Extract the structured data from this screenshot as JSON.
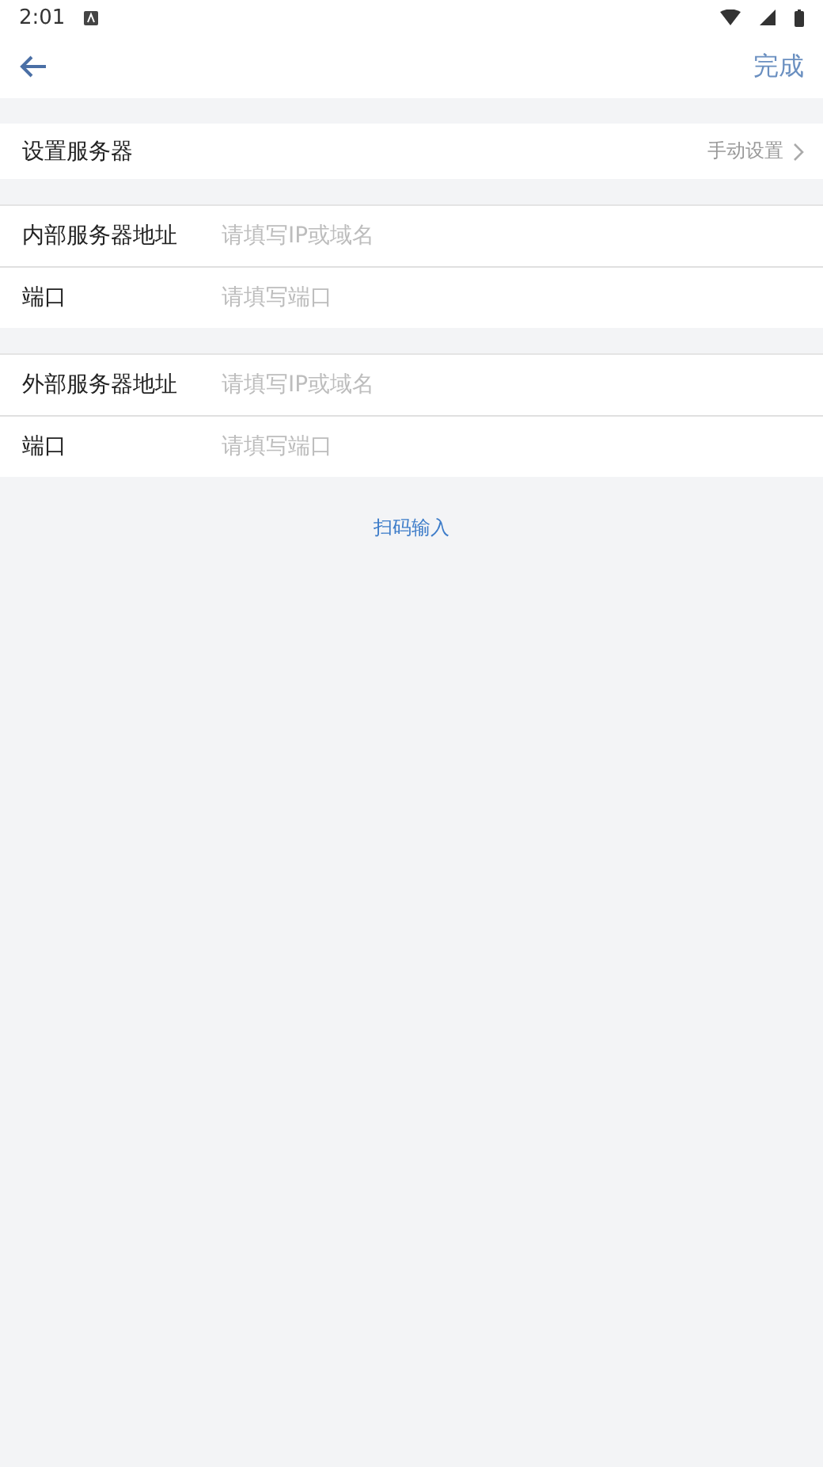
{
  "status_bar": {
    "time": "2:01"
  },
  "header": {
    "action": "完成"
  },
  "server_mode": {
    "label": "设置服务器",
    "value": "手动设置"
  },
  "groups": [
    {
      "fields": [
        {
          "label": "内部服务器地址",
          "placeholder": "请填写IP或域名"
        },
        {
          "label": "端口",
          "placeholder": "请填写端口"
        }
      ]
    },
    {
      "fields": [
        {
          "label": "外部服务器地址",
          "placeholder": "请填写IP或域名"
        },
        {
          "label": "端口",
          "placeholder": "请填写端口"
        }
      ]
    }
  ],
  "scan_link": "扫码输入"
}
